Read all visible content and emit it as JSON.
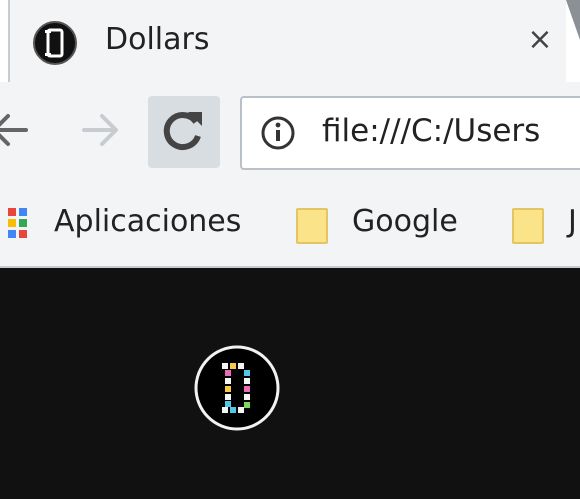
{
  "tab": {
    "title": "Dollars",
    "close_label": "×"
  },
  "toolbar": {
    "url": "file:///C:/Users"
  },
  "bookmarks": {
    "items": [
      {
        "label": "Aplicaciones",
        "icon": "apps-grid-icon"
      },
      {
        "label": "Google",
        "icon": "folder-icon"
      },
      {
        "label": "J",
        "icon": "folder-icon"
      }
    ]
  },
  "colors": {
    "chrome": "#f2f4f6",
    "page_background": "#111111",
    "folder": "#fbe38a"
  }
}
